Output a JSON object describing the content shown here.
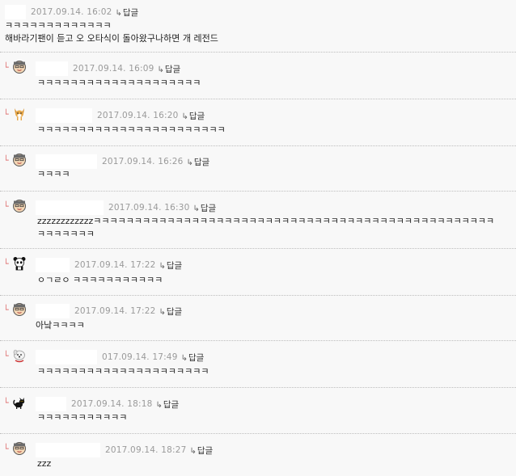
{
  "reply_label": "답글",
  "comments": [
    {
      "date": "2017.09.14. 16:02",
      "lines": [
        "ㅋㅋㅋㅋㅋㅋㅋㅋㅋㅋㅋㅋㅋ",
        "해바라기팬이 듣고 오 오타식이 돌아왔구나하면 개 레전드"
      ],
      "avatar": "none"
    },
    {
      "date": "2017.09.14. 16:09",
      "lines": [
        "ㅋㅋㅋㅋㅋㅋㅋㅋㅋㅋㅋㅋㅋㅋㅋㅋㅋㅋㅋㅋ"
      ],
      "avatar": "face-icon"
    },
    {
      "date": "2017.09.14. 16:20",
      "lines": [
        "ㅋㅋㅋㅋㅋㅋㅋㅋㅋㅋㅋㅋㅋㅋㅋㅋㅋㅋㅋㅋㅋㅋㅋ"
      ],
      "avatar": "dog-icon"
    },
    {
      "date": "2017.09.14. 16:26",
      "lines": [
        "ㅋㅋㅋㅋ"
      ],
      "avatar": "face-icon"
    },
    {
      "date": "2017.09.14. 16:30",
      "lines": [
        "zzzzzzzzzzzzㅋㅋㅋㅋㅋㅋㅋㅋㅋㅋㅋㅋㅋㅋㅋㅋㅋㅋㅋㅋㅋㅋㅋㅋㅋㅋㅋㅋㅋㅋㅋㅋㅋㅋㅋㅋㅋㅋㅋㅋㅋㅋㅋㅋㅋㅋㅋㅋㅋ",
        "ㅋㅋㅋㅋㅋㅋㅋ"
      ],
      "avatar": "face-icon"
    },
    {
      "date": "2017.09.14. 17:22",
      "lines": [
        "ㅇㄱㄹㅇ ㅋㅋㅋㅋㅋㅋㅋㅋㅋㅋㅋ"
      ],
      "avatar": "panda-icon"
    },
    {
      "date": "2017.09.14. 17:22",
      "lines": [
        "아낰ㅋㅋㅋㅋ"
      ],
      "avatar": "face-icon"
    },
    {
      "date": "017.09.14. 17:49",
      "lines": [
        "ㅋㅋㅋㅋㅋㅋㅋㅋㅋㅋㅋㅋㅋㅋㅋㅋㅋㅋㅋㅋㅋ"
      ],
      "avatar": "white-dog-icon"
    },
    {
      "date": "2017.09.14. 18:18",
      "lines": [
        "ㅋㅋㅋㅋㅋㅋㅋㅋㅋㅋㅋ"
      ],
      "avatar": "black-cat-icon"
    },
    {
      "date": "2017.09.14. 18:27",
      "lines": [
        "zzz"
      ],
      "avatar": "face-icon"
    }
  ]
}
